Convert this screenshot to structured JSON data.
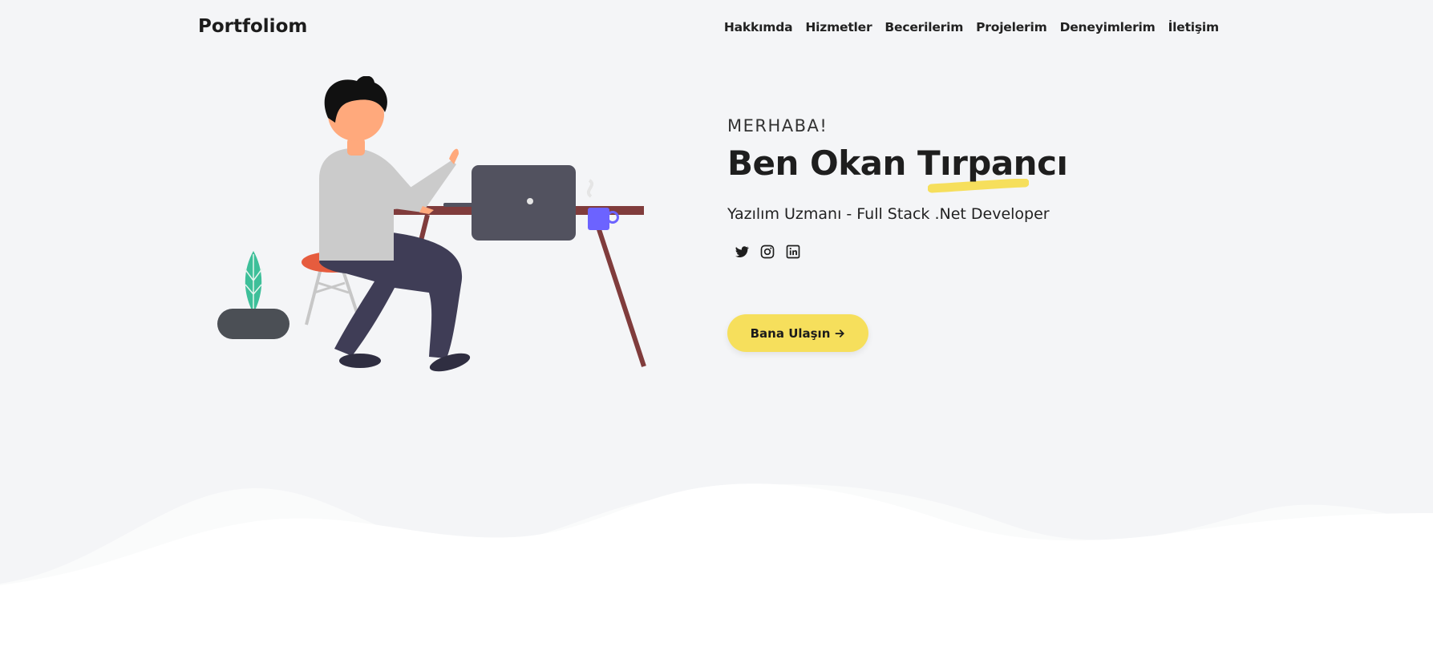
{
  "navbar": {
    "brand": "Portfoliom",
    "links": [
      "Hakkımda",
      "Hizmetler",
      "Becerilerim",
      "Projelerim",
      "Deneyimlerim",
      "İletişim"
    ]
  },
  "hero": {
    "greeting": "MERHABA!",
    "name": "Ben Okan Tırpancı",
    "subtitle": "Yazılım Uzmanı - Full Stack .Net Developer",
    "socials": [
      {
        "icon": "twitter-icon"
      },
      {
        "icon": "instagram-icon"
      },
      {
        "icon": "linkedin-icon"
      }
    ],
    "cta_label": "Bana Ulaşın",
    "cta_icon": "arrow-right-icon"
  },
  "colors": {
    "background": "#f4f5f7",
    "accent": "#f6df5c",
    "text": "#1e1e1e"
  }
}
